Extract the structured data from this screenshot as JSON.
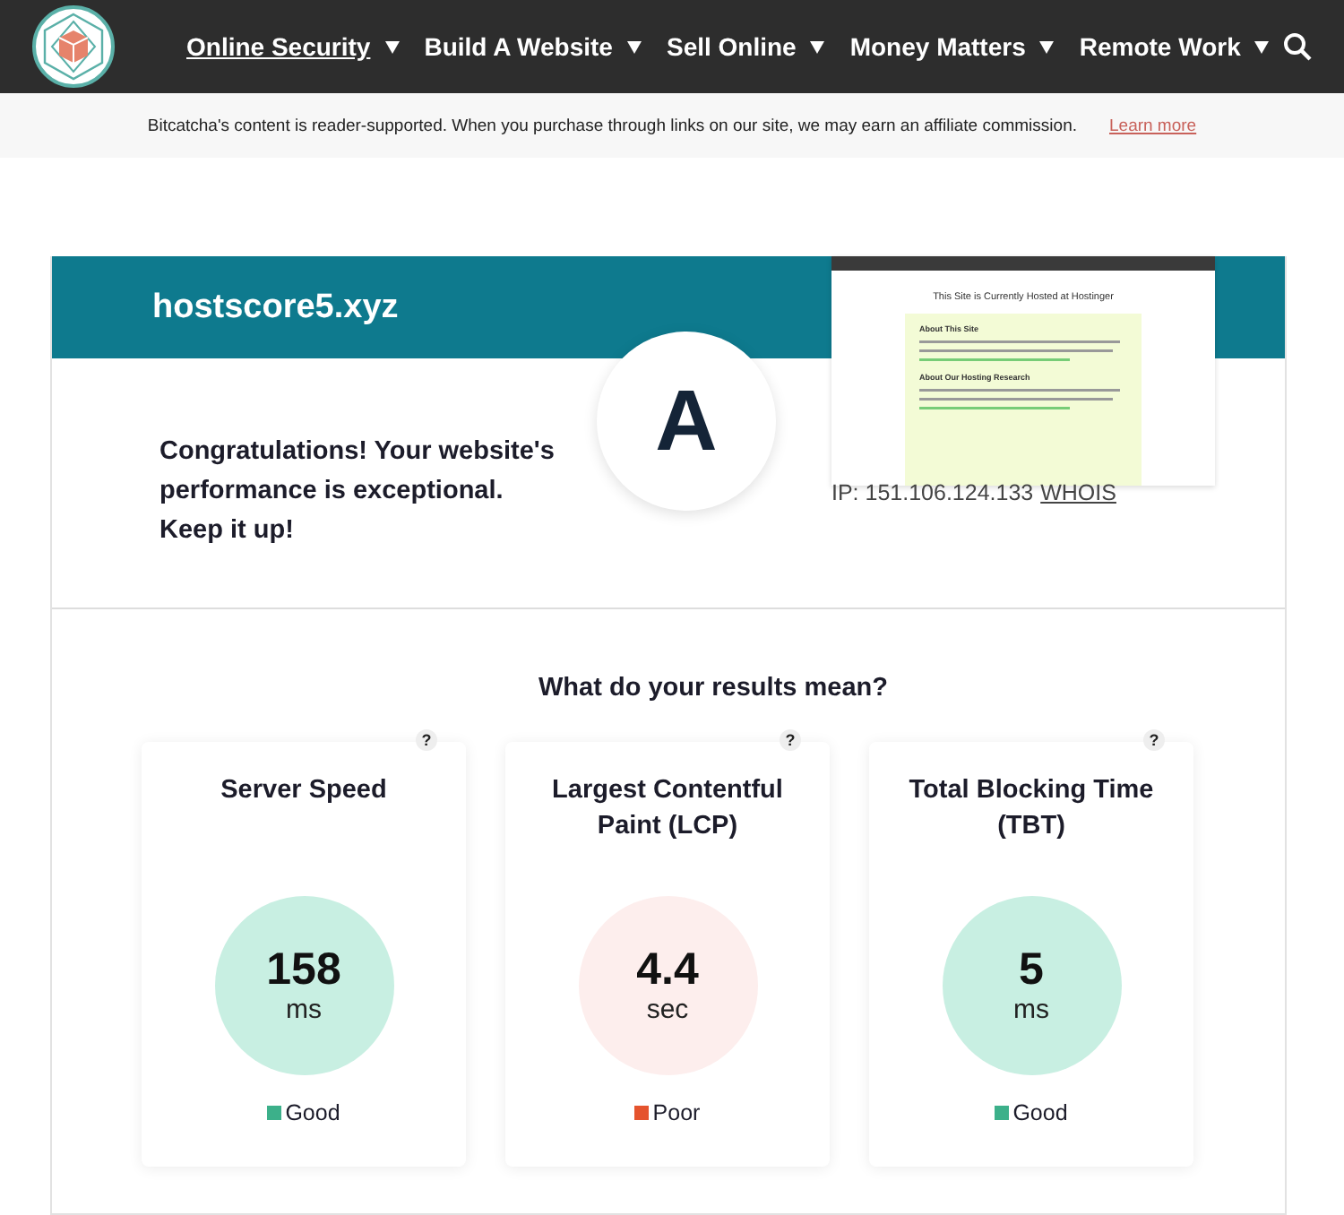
{
  "nav": {
    "items": [
      {
        "label": "Online Security",
        "selected": true
      },
      {
        "label": "Build A Website",
        "selected": false
      },
      {
        "label": "Sell Online",
        "selected": false
      },
      {
        "label": "Money Matters",
        "selected": false
      },
      {
        "label": "Remote Work",
        "selected": false
      }
    ]
  },
  "notice": {
    "text": "Bitcatcha's content is reader-supported. When you purchase through links on our site, we may earn an affiliate commission.",
    "link": "Learn more"
  },
  "result": {
    "domain": "hostscore5.xyz",
    "grade": "A",
    "message": "Congratulations! Your website's performance is exceptional. Keep it up!",
    "ip": "IP: 151.106.124.133",
    "whois": "WHOIS",
    "preview": {
      "title": "This Site is Currently Hosted at Hostinger",
      "headings": [
        "About This Site",
        "About Our Hosting Research"
      ]
    }
  },
  "explain": {
    "title": "What do your results mean?",
    "help": "?",
    "metrics": [
      {
        "title": "Server Speed",
        "value": "158",
        "unit": "ms",
        "status": "Good",
        "kind": "good",
        "color": "#3cb08a"
      },
      {
        "title": "Largest Contentful Paint (LCP)",
        "value": "4.4",
        "unit": "sec",
        "status": "Poor",
        "kind": "poor",
        "color": "#e5532d"
      },
      {
        "title": "Total Blocking Time (TBT)",
        "value": "5",
        "unit": "ms",
        "status": "Good",
        "kind": "good",
        "color": "#3cb08a"
      }
    ]
  }
}
